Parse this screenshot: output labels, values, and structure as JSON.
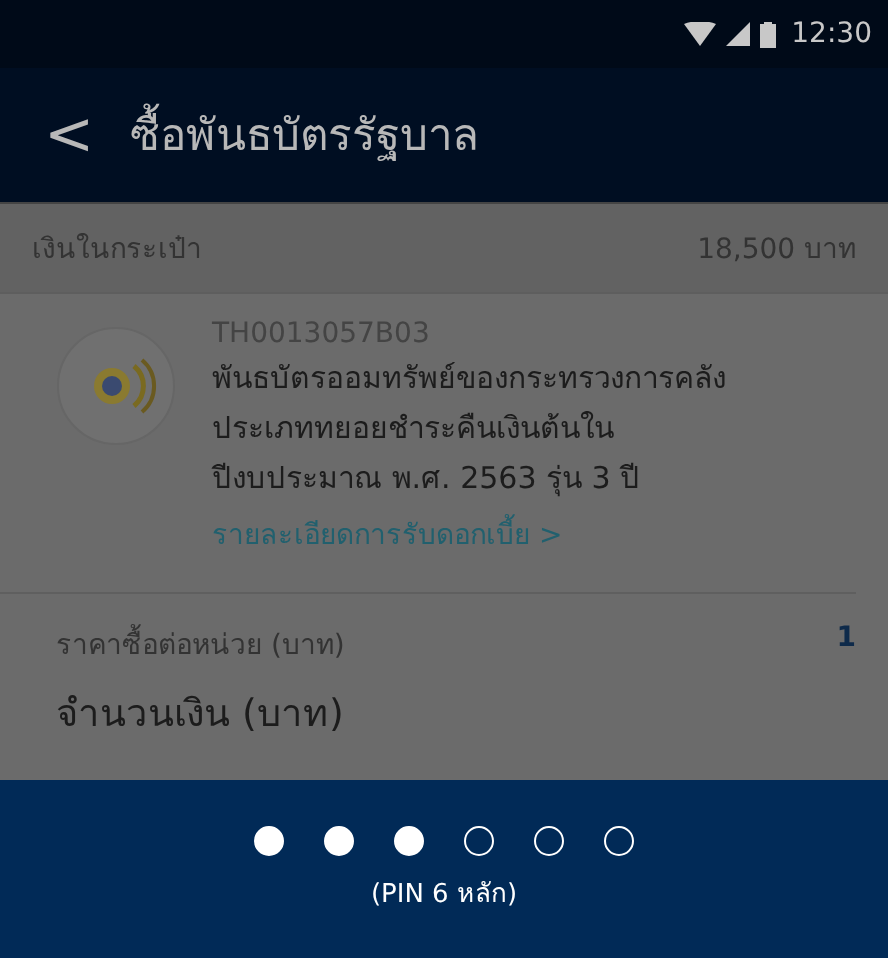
{
  "status_bar": {
    "time": "12:30"
  },
  "header": {
    "back": "<",
    "title": "ซื้อพันธบัตรรัฐบาล"
  },
  "wallet": {
    "label": "เงินในกระเป๋า",
    "value": "18,500 บาท"
  },
  "bond": {
    "code": "TH0013057B03",
    "name": "พันธบัตรออมทรัพย์ของกระทรวงการคลังประเภททยอยชำระคืนเงินต้นในปีงบประมาณ พ.ศ. 2563 รุ่น 3 ปี",
    "link": "รายละเอียดการรับดอกเบี้ย >"
  },
  "price": {
    "label": "ราคาซื้อต่อหน่วย (บาท)",
    "value": "1"
  },
  "amount": {
    "label": "จำนวนเงิน (บาท)"
  },
  "pin": {
    "hint": "(PIN 6 หลัก)",
    "dots": [
      {
        "filled": true
      },
      {
        "filled": true
      },
      {
        "filled": true
      },
      {
        "filled": false
      },
      {
        "filled": false
      },
      {
        "filled": false
      }
    ]
  }
}
